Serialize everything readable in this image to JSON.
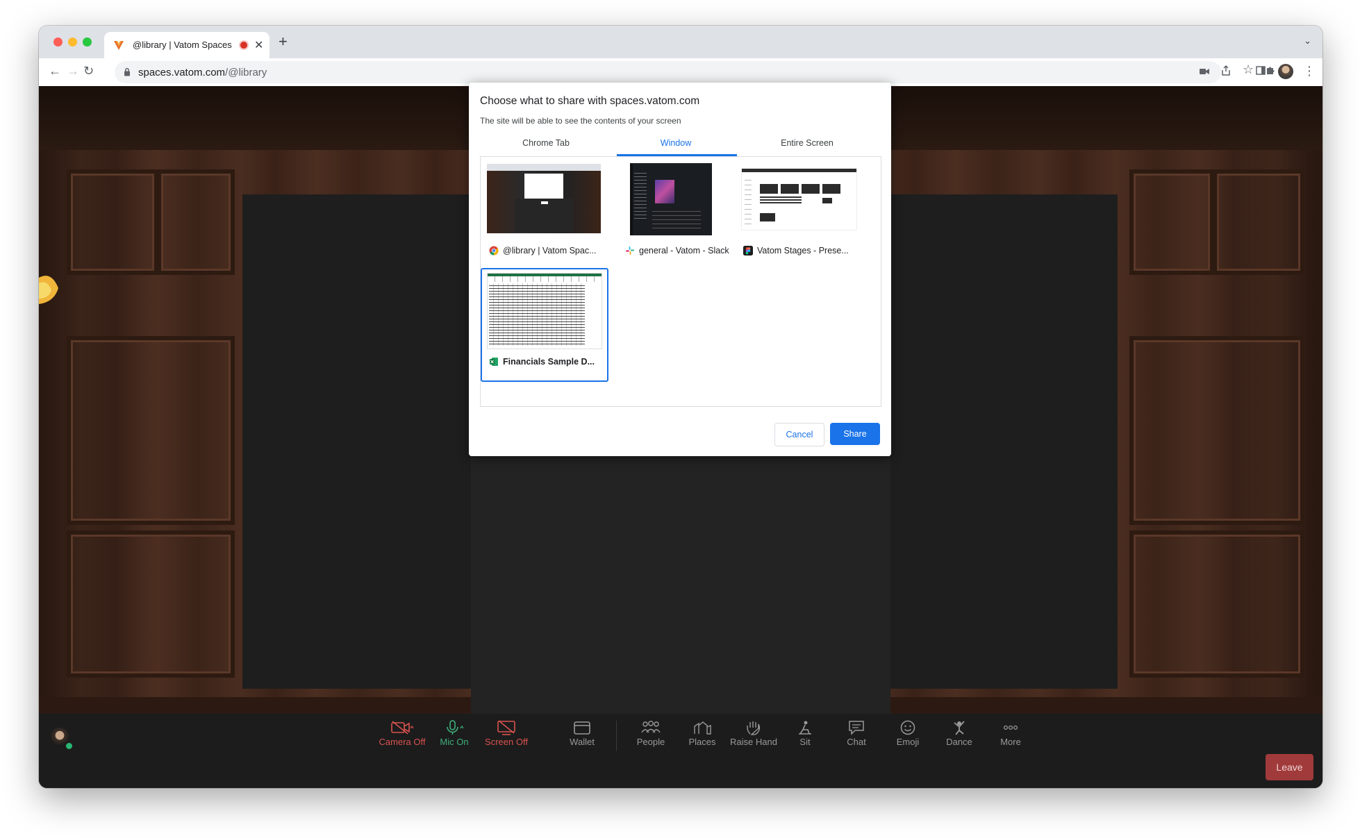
{
  "browser": {
    "tab_title": "@library | Vatom Spaces",
    "url_host": "spaces.vatom.com",
    "url_path": "/@library"
  },
  "dialog": {
    "title": "Choose what to share with spaces.vatom.com",
    "subtitle": "The site will be able to see the contents of your screen",
    "tabs": [
      "Chrome Tab",
      "Window",
      "Entire Screen"
    ],
    "active_tab": "Window",
    "windows": [
      {
        "label": "@library | Vatom Spac...",
        "icon": "chrome-icon"
      },
      {
        "label": "general - Vatom - Slack",
        "icon": "slack-icon"
      },
      {
        "label": "Vatom Stages - Prese...",
        "icon": "figma-icon"
      },
      {
        "label": "Financials Sample D...",
        "icon": "excel-icon",
        "selected": true
      }
    ],
    "cancel_label": "Cancel",
    "share_label": "Share"
  },
  "controls": [
    {
      "label": "Camera Off",
      "icon": "camera-off-icon",
      "state": "off"
    },
    {
      "label": "Mic On",
      "icon": "mic-icon",
      "state": "on"
    },
    {
      "label": "Screen Off",
      "icon": "screen-off-icon",
      "state": "off"
    },
    {
      "label": "Wallet",
      "icon": "wallet-icon"
    },
    {
      "label": "People",
      "icon": "people-icon"
    },
    {
      "label": "Places",
      "icon": "places-icon"
    },
    {
      "label": "Raise Hand",
      "icon": "hand-icon"
    },
    {
      "label": "Sit",
      "icon": "sit-icon"
    },
    {
      "label": "Chat",
      "icon": "chat-icon"
    },
    {
      "label": "Emoji",
      "icon": "emoji-icon"
    },
    {
      "label": "Dance",
      "icon": "dance-icon"
    },
    {
      "label": "More",
      "icon": "more-icon"
    }
  ],
  "leave_label": "Leave",
  "colors": {
    "accent": "#1a73e8",
    "off": "#d9534f",
    "on": "#3fb07c",
    "leave": "#a13a3a"
  }
}
